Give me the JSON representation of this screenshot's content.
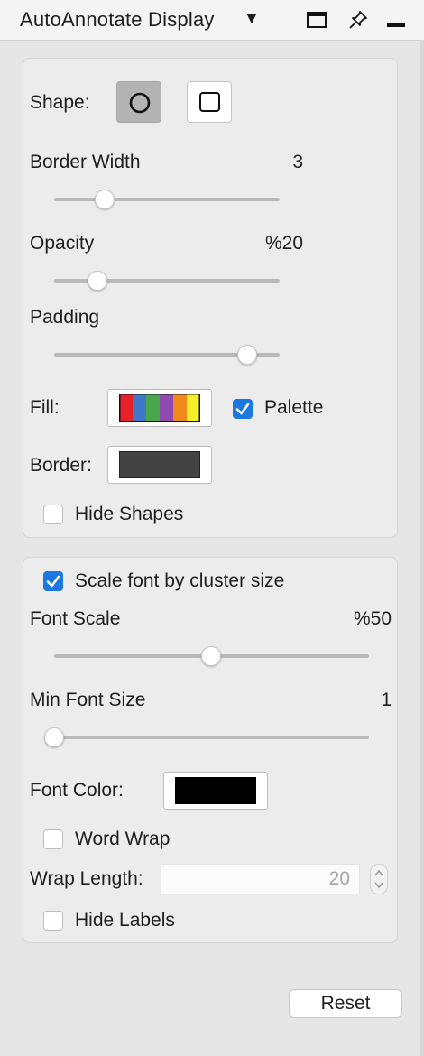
{
  "window": {
    "title": "AutoAnnotate Display"
  },
  "shapes_panel": {
    "shape_label": "Shape:",
    "shape_options": [
      "ellipse",
      "rectangle"
    ],
    "selected_shape": "ellipse",
    "border_width_label": "Border Width",
    "border_width_value": "3",
    "border_width_fraction": 0.23,
    "opacity_label": "Opacity",
    "opacity_value": "%20",
    "opacity_fraction": 0.2,
    "padding_label": "Padding",
    "padding_fraction": 0.85,
    "fill_label": "Fill:",
    "fill_palette_colors": [
      "#e8202a",
      "#3f78c8",
      "#4aa64a",
      "#8e4ab0",
      "#f08a1a",
      "#f7ee2a"
    ],
    "palette_label": "Palette",
    "palette_checked": true,
    "border_label": "Border:",
    "border_color": "#434343",
    "hide_shapes_label": "Hide Shapes",
    "hide_shapes_checked": false
  },
  "labels_panel": {
    "scale_font_label": "Scale font by cluster size",
    "scale_font_checked": true,
    "font_scale_label": "Font Scale",
    "font_scale_value": "%50",
    "font_scale_fraction": 0.5,
    "min_font_size_label": "Min Font Size",
    "min_font_size_value": "1",
    "min_font_size_fraction": 0.0,
    "font_color_label": "Font Color:",
    "font_color": "#000000",
    "word_wrap_label": "Word Wrap",
    "word_wrap_checked": false,
    "wrap_length_label": "Wrap Length:",
    "wrap_length_value": "20",
    "hide_labels_label": "Hide Labels",
    "hide_labels_checked": false
  },
  "reset_label": "Reset",
  "colors": {
    "checkbox_accent": "#1a78e0",
    "selected_shape_bg": "#b3b3b3"
  }
}
